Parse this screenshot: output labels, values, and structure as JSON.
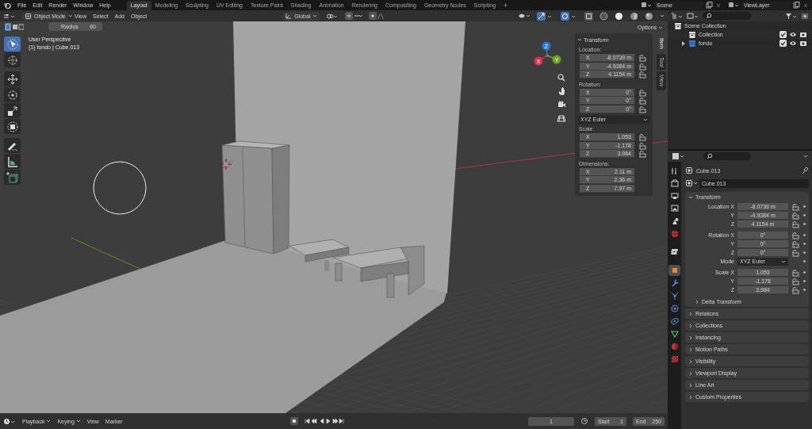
{
  "menu": [
    "File",
    "Edit",
    "Render",
    "Window",
    "Help"
  ],
  "workspaces": [
    {
      "label": "Layout",
      "selected": true
    },
    {
      "label": "Modeling",
      "selected": false
    },
    {
      "label": "Sculpting",
      "selected": false
    },
    {
      "label": "UV Editing",
      "selected": false
    },
    {
      "label": "Texture Paint",
      "selected": false
    },
    {
      "label": "Shading",
      "selected": false
    },
    {
      "label": "Animation",
      "selected": false
    },
    {
      "label": "Rendering",
      "selected": false
    },
    {
      "label": "Compositing",
      "selected": false
    },
    {
      "label": "Geometry Nodes",
      "selected": false
    },
    {
      "label": "Scripting",
      "selected": false
    }
  ],
  "add_workspace": "+",
  "scene": "Scene",
  "view_layer": "ViewLayer",
  "viewport_header": {
    "mode": "Object Mode",
    "menus": [
      "View",
      "Select",
      "Add",
      "Object"
    ],
    "orientation": "Global"
  },
  "tool_settings": {
    "label": "Radius",
    "value": "60"
  },
  "tools": [
    {
      "kind": "select",
      "selected": true
    },
    {
      "kind": "cursor",
      "selected": false
    },
    {
      "kind": "move",
      "selected": false
    },
    {
      "kind": "rotate",
      "selected": false
    },
    {
      "kind": "scale",
      "selected": false
    },
    {
      "kind": "transform",
      "selected": false
    },
    {
      "kind": "annotate",
      "selected": false
    },
    {
      "kind": "measure",
      "selected": false
    },
    {
      "kind": "add_cube",
      "selected": false
    }
  ],
  "overlay_text": [
    "User Perspective",
    "(1) fondo | Cube.013"
  ],
  "gizmo_axes": [
    {
      "label": "Z",
      "color": "#2e78d0"
    },
    {
      "label": "Y",
      "color": "#6ba523"
    },
    {
      "label": "X",
      "color": "#d8354c"
    }
  ],
  "options": "Options",
  "n_panel": {
    "title": "Transform",
    "expanded": true,
    "groups": [
      {
        "kind": "vector",
        "label": "Location:",
        "lockable": true,
        "rows": [
          {
            "axis": "X",
            "value": "-8.0739 m"
          },
          {
            "axis": "Y",
            "value": "-4.9384 m"
          },
          {
            "axis": "Z",
            "value": "4.1154 m"
          }
        ]
      },
      {
        "kind": "vector",
        "label": "Rotation:",
        "lockable": true,
        "rows": [
          {
            "axis": "X",
            "value": "0°"
          },
          {
            "axis": "Y",
            "value": "0°"
          },
          {
            "axis": "Z",
            "value": "0°"
          }
        ]
      },
      {
        "kind": "dropdown",
        "value": "XYZ Euler"
      },
      {
        "kind": "vector",
        "label": "Scale:",
        "lockable": true,
        "rows": [
          {
            "axis": "X",
            "value": "1.053"
          },
          {
            "axis": "Y",
            "value": "-1.178"
          },
          {
            "axis": "Z",
            "value": "3.984"
          }
        ]
      },
      {
        "kind": "vector",
        "label": "Dimensions:",
        "lockable": false,
        "rows": [
          {
            "axis": "X",
            "value": "2.11 m"
          },
          {
            "axis": "Y",
            "value": "2.36 m"
          },
          {
            "axis": "Z",
            "value": "7.97 m"
          }
        ]
      }
    ]
  },
  "sidebar_tabs": [
    {
      "label": "Item",
      "selected": true
    },
    {
      "label": "Tool",
      "selected": false
    },
    {
      "label": "View",
      "selected": false
    }
  ],
  "outliner": {
    "items": [
      {
        "label": "Scene Collection",
        "children": [
          {
            "label": "Collection",
            "color": "#e0e0e0",
            "checked": true
          },
          {
            "label": "fondo",
            "color": "#3d7fd3",
            "expanded": false,
            "checked": true
          }
        ]
      }
    ]
  },
  "properties": {
    "tabs": [
      {
        "kind": "tool",
        "selected": false
      },
      {
        "kind": "render",
        "selected": false
      },
      {
        "kind": "output",
        "selected": false
      },
      {
        "kind": "view_layer",
        "selected": false
      },
      {
        "kind": "scene",
        "selected": false
      },
      {
        "kind": "world",
        "selected": false
      },
      {
        "kind": "collection",
        "selected": false
      },
      {
        "kind": "object",
        "selected": true
      },
      {
        "kind": "modifiers",
        "selected": false
      },
      {
        "kind": "particles",
        "selected": false
      },
      {
        "kind": "physics",
        "selected": false
      },
      {
        "kind": "constraints",
        "selected": false
      },
      {
        "kind": "data",
        "selected": false
      },
      {
        "kind": "material",
        "selected": false
      },
      {
        "kind": "texture",
        "selected": false
      }
    ],
    "object_name": "Cube.013",
    "datablock": "Cube.013",
    "transform": {
      "title": "Transform",
      "expanded": true,
      "groups": [
        {
          "rows": [
            {
              "kind": "field",
              "label": "Location X",
              "value": "-8.0739 m"
            },
            {
              "kind": "field",
              "label": "Y",
              "value": "-4.9384 m"
            },
            {
              "kind": "field",
              "label": "Z",
              "value": "4.1154 m"
            }
          ]
        },
        {
          "rows": [
            {
              "kind": "field",
              "label": "Rotation X",
              "value": "0°"
            },
            {
              "kind": "field",
              "label": "Y",
              "value": "0°"
            },
            {
              "kind": "field",
              "label": "Z",
              "value": "0°"
            },
            {
              "kind": "dropdown",
              "label": "Mode",
              "value": "XYZ Euler"
            }
          ]
        },
        {
          "rows": [
            {
              "kind": "field",
              "label": "Scale X",
              "value": "1.053"
            },
            {
              "kind": "field",
              "label": "Y",
              "value": "-1.178"
            },
            {
              "kind": "field",
              "label": "Z",
              "value": "3.984"
            }
          ]
        }
      ],
      "subpanels": [
        {
          "label": "Delta Transform",
          "expanded": false
        }
      ]
    },
    "panels": [
      {
        "label": "Relations",
        "expanded": false
      },
      {
        "label": "Collections",
        "expanded": false
      },
      {
        "label": "Instancing",
        "expanded": false
      },
      {
        "label": "Motion Paths",
        "expanded": false
      },
      {
        "label": "Visibility",
        "expanded": false
      },
      {
        "label": "Viewport Display",
        "expanded": false
      },
      {
        "label": "Line Art",
        "expanded": false
      },
      {
        "label": "Custom Properties",
        "expanded": false
      }
    ]
  },
  "timeline": {
    "menus": [
      {
        "label": "Playback",
        "dropdown": true
      },
      {
        "label": "Keying",
        "dropdown": true
      },
      {
        "label": "View",
        "dropdown": false
      },
      {
        "label": "Marker",
        "dropdown": false
      }
    ],
    "current_frame": "1",
    "start_label": "Start",
    "start": "1",
    "end_label": "End",
    "end": "250"
  }
}
